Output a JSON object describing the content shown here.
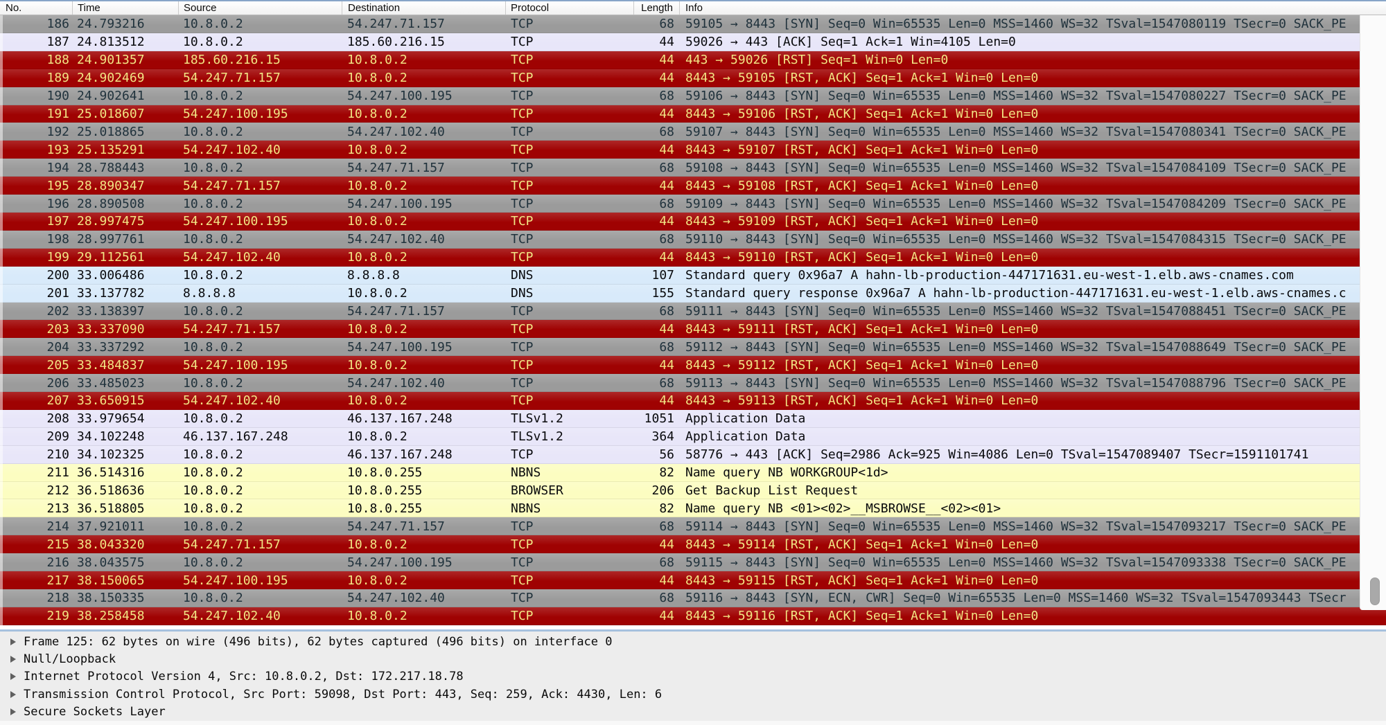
{
  "columns": [
    "No.",
    "Time",
    "Source",
    "Destination",
    "Protocol",
    "Length",
    "Info"
  ],
  "row_styles": {
    "gray": {
      "bg": "#9B9B9B",
      "fg": "#20323C"
    },
    "red": {
      "bg": "#9F0202",
      "fg": "#F2E584"
    },
    "lavender": {
      "bg": "#E8E6F9",
      "fg": "#08090C"
    },
    "blue": {
      "bg": "#D8EAFA",
      "fg": "#08090C"
    },
    "yellow": {
      "bg": "#FCFDC1",
      "fg": "#08090C"
    }
  },
  "chrome": {
    "top_border": "#87A5C8",
    "splitter_blue": "#A6C1DE",
    "scrollbar_thumb": "#A9A9A9",
    "header_separator": "#CBCBCB"
  },
  "packets": [
    {
      "no": "186",
      "time": "24.793216",
      "source": "10.8.0.2",
      "destination": "54.247.71.157",
      "protocol": "TCP",
      "length": "68",
      "info": "59105 → 8443 [SYN] Seq=0 Win=65535 Len=0 MSS=1460 WS=32 TSval=1547080119 TSecr=0 SACK_PE",
      "style": "gray"
    },
    {
      "no": "187",
      "time": "24.813512",
      "source": "10.8.0.2",
      "destination": "185.60.216.15",
      "protocol": "TCP",
      "length": "44",
      "info": "59026 → 443 [ACK] Seq=1 Ack=1 Win=4105 Len=0",
      "style": "lavender"
    },
    {
      "no": "188",
      "time": "24.901357",
      "source": "185.60.216.15",
      "destination": "10.8.0.2",
      "protocol": "TCP",
      "length": "44",
      "info": "443 → 59026 [RST] Seq=1 Win=0 Len=0",
      "style": "red"
    },
    {
      "no": "189",
      "time": "24.902469",
      "source": "54.247.71.157",
      "destination": "10.8.0.2",
      "protocol": "TCP",
      "length": "44",
      "info": "8443 → 59105 [RST, ACK] Seq=1 Ack=1 Win=0 Len=0",
      "style": "red"
    },
    {
      "no": "190",
      "time": "24.902641",
      "source": "10.8.0.2",
      "destination": "54.247.100.195",
      "protocol": "TCP",
      "length": "68",
      "info": "59106 → 8443 [SYN] Seq=0 Win=65535 Len=0 MSS=1460 WS=32 TSval=1547080227 TSecr=0 SACK_PE",
      "style": "gray"
    },
    {
      "no": "191",
      "time": "25.018607",
      "source": "54.247.100.195",
      "destination": "10.8.0.2",
      "protocol": "TCP",
      "length": "44",
      "info": "8443 → 59106 [RST, ACK] Seq=1 Ack=1 Win=0 Len=0",
      "style": "red"
    },
    {
      "no": "192",
      "time": "25.018865",
      "source": "10.8.0.2",
      "destination": "54.247.102.40",
      "protocol": "TCP",
      "length": "68",
      "info": "59107 → 8443 [SYN] Seq=0 Win=65535 Len=0 MSS=1460 WS=32 TSval=1547080341 TSecr=0 SACK_PE",
      "style": "gray"
    },
    {
      "no": "193",
      "time": "25.135291",
      "source": "54.247.102.40",
      "destination": "10.8.0.2",
      "protocol": "TCP",
      "length": "44",
      "info": "8443 → 59107 [RST, ACK] Seq=1 Ack=1 Win=0 Len=0",
      "style": "red"
    },
    {
      "no": "194",
      "time": "28.788443",
      "source": "10.8.0.2",
      "destination": "54.247.71.157",
      "protocol": "TCP",
      "length": "68",
      "info": "59108 → 8443 [SYN] Seq=0 Win=65535 Len=0 MSS=1460 WS=32 TSval=1547084109 TSecr=0 SACK_PE",
      "style": "gray"
    },
    {
      "no": "195",
      "time": "28.890347",
      "source": "54.247.71.157",
      "destination": "10.8.0.2",
      "protocol": "TCP",
      "length": "44",
      "info": "8443 → 59108 [RST, ACK] Seq=1 Ack=1 Win=0 Len=0",
      "style": "red"
    },
    {
      "no": "196",
      "time": "28.890508",
      "source": "10.8.0.2",
      "destination": "54.247.100.195",
      "protocol": "TCP",
      "length": "68",
      "info": "59109 → 8443 [SYN] Seq=0 Win=65535 Len=0 MSS=1460 WS=32 TSval=1547084209 TSecr=0 SACK_PE",
      "style": "gray"
    },
    {
      "no": "197",
      "time": "28.997475",
      "source": "54.247.100.195",
      "destination": "10.8.0.2",
      "protocol": "TCP",
      "length": "44",
      "info": "8443 → 59109 [RST, ACK] Seq=1 Ack=1 Win=0 Len=0",
      "style": "red"
    },
    {
      "no": "198",
      "time": "28.997761",
      "source": "10.8.0.2",
      "destination": "54.247.102.40",
      "protocol": "TCP",
      "length": "68",
      "info": "59110 → 8443 [SYN] Seq=0 Win=65535 Len=0 MSS=1460 WS=32 TSval=1547084315 TSecr=0 SACK_PE",
      "style": "gray"
    },
    {
      "no": "199",
      "time": "29.112561",
      "source": "54.247.102.40",
      "destination": "10.8.0.2",
      "protocol": "TCP",
      "length": "44",
      "info": "8443 → 59110 [RST, ACK] Seq=1 Ack=1 Win=0 Len=0",
      "style": "red"
    },
    {
      "no": "200",
      "time": "33.006486",
      "source": "10.8.0.2",
      "destination": "8.8.8.8",
      "protocol": "DNS",
      "length": "107",
      "info": "Standard query 0x96a7 A hahn-lb-production-447171631.eu-west-1.elb.aws-cnames.com",
      "style": "blue"
    },
    {
      "no": "201",
      "time": "33.137782",
      "source": "8.8.8.8",
      "destination": "10.8.0.2",
      "protocol": "DNS",
      "length": "155",
      "info": "Standard query response 0x96a7 A hahn-lb-production-447171631.eu-west-1.elb.aws-cnames.c",
      "style": "blue"
    },
    {
      "no": "202",
      "time": "33.138397",
      "source": "10.8.0.2",
      "destination": "54.247.71.157",
      "protocol": "TCP",
      "length": "68",
      "info": "59111 → 8443 [SYN] Seq=0 Win=65535 Len=0 MSS=1460 WS=32 TSval=1547088451 TSecr=0 SACK_PE",
      "style": "gray"
    },
    {
      "no": "203",
      "time": "33.337090",
      "source": "54.247.71.157",
      "destination": "10.8.0.2",
      "protocol": "TCP",
      "length": "44",
      "info": "8443 → 59111 [RST, ACK] Seq=1 Ack=1 Win=0 Len=0",
      "style": "red"
    },
    {
      "no": "204",
      "time": "33.337292",
      "source": "10.8.0.2",
      "destination": "54.247.100.195",
      "protocol": "TCP",
      "length": "68",
      "info": "59112 → 8443 [SYN] Seq=0 Win=65535 Len=0 MSS=1460 WS=32 TSval=1547088649 TSecr=0 SACK_PE",
      "style": "gray"
    },
    {
      "no": "205",
      "time": "33.484837",
      "source": "54.247.100.195",
      "destination": "10.8.0.2",
      "protocol": "TCP",
      "length": "44",
      "info": "8443 → 59112 [RST, ACK] Seq=1 Ack=1 Win=0 Len=0",
      "style": "red"
    },
    {
      "no": "206",
      "time": "33.485023",
      "source": "10.8.0.2",
      "destination": "54.247.102.40",
      "protocol": "TCP",
      "length": "68",
      "info": "59113 → 8443 [SYN] Seq=0 Win=65535 Len=0 MSS=1460 WS=32 TSval=1547088796 TSecr=0 SACK_PE",
      "style": "gray"
    },
    {
      "no": "207",
      "time": "33.650915",
      "source": "54.247.102.40",
      "destination": "10.8.0.2",
      "protocol": "TCP",
      "length": "44",
      "info": "8443 → 59113 [RST, ACK] Seq=1 Ack=1 Win=0 Len=0",
      "style": "red"
    },
    {
      "no": "208",
      "time": "33.979654",
      "source": "10.8.0.2",
      "destination": "46.137.167.248",
      "protocol": "TLSv1.2",
      "length": "1051",
      "info": "Application Data",
      "style": "lavender"
    },
    {
      "no": "209",
      "time": "34.102248",
      "source": "46.137.167.248",
      "destination": "10.8.0.2",
      "protocol": "TLSv1.2",
      "length": "364",
      "info": "Application Data",
      "style": "lavender"
    },
    {
      "no": "210",
      "time": "34.102325",
      "source": "10.8.0.2",
      "destination": "46.137.167.248",
      "protocol": "TCP",
      "length": "56",
      "info": "58776 → 443 [ACK] Seq=2986 Ack=925 Win=4086 Len=0 TSval=1547089407 TSecr=1591101741",
      "style": "lavender"
    },
    {
      "no": "211",
      "time": "36.514316",
      "source": "10.8.0.2",
      "destination": "10.8.0.255",
      "protocol": "NBNS",
      "length": "82",
      "info": "Name query NB WORKGROUP<1d>",
      "style": "yellow"
    },
    {
      "no": "212",
      "time": "36.518636",
      "source": "10.8.0.2",
      "destination": "10.8.0.255",
      "protocol": "BROWSER",
      "length": "206",
      "info": "Get Backup List Request",
      "style": "yellow"
    },
    {
      "no": "213",
      "time": "36.518805",
      "source": "10.8.0.2",
      "destination": "10.8.0.255",
      "protocol": "NBNS",
      "length": "82",
      "info": "Name query NB <01><02>__MSBROWSE__<02><01>",
      "style": "yellow"
    },
    {
      "no": "214",
      "time": "37.921011",
      "source": "10.8.0.2",
      "destination": "54.247.71.157",
      "protocol": "TCP",
      "length": "68",
      "info": "59114 → 8443 [SYN] Seq=0 Win=65535 Len=0 MSS=1460 WS=32 TSval=1547093217 TSecr=0 SACK_PE",
      "style": "gray"
    },
    {
      "no": "215",
      "time": "38.043320",
      "source": "54.247.71.157",
      "destination": "10.8.0.2",
      "protocol": "TCP",
      "length": "44",
      "info": "8443 → 59114 [RST, ACK] Seq=1 Ack=1 Win=0 Len=0",
      "style": "red"
    },
    {
      "no": "216",
      "time": "38.043575",
      "source": "10.8.0.2",
      "destination": "54.247.100.195",
      "protocol": "TCP",
      "length": "68",
      "info": "59115 → 8443 [SYN] Seq=0 Win=65535 Len=0 MSS=1460 WS=32 TSval=1547093338 TSecr=0 SACK_PE",
      "style": "gray"
    },
    {
      "no": "217",
      "time": "38.150065",
      "source": "54.247.100.195",
      "destination": "10.8.0.2",
      "protocol": "TCP",
      "length": "44",
      "info": "8443 → 59115 [RST, ACK] Seq=1 Ack=1 Win=0 Len=0",
      "style": "red"
    },
    {
      "no": "218",
      "time": "38.150335",
      "source": "10.8.0.2",
      "destination": "54.247.102.40",
      "protocol": "TCP",
      "length": "68",
      "info": "59116 → 8443 [SYN, ECN, CWR] Seq=0 Win=65535 Len=0 MSS=1460 WS=32 TSval=1547093443 TSecr",
      "style": "gray"
    },
    {
      "no": "219",
      "time": "38.258458",
      "source": "54.247.102.40",
      "destination": "10.8.0.2",
      "protocol": "TCP",
      "length": "44",
      "info": "8443 → 59116 [RST, ACK] Seq=1 Ack=1 Win=0 Len=0",
      "style": "red"
    }
  ],
  "details": [
    "Frame 125: 62 bytes on wire (496 bits), 62 bytes captured (496 bits) on interface 0",
    "Null/Loopback",
    "Internet Protocol Version 4, Src: 10.8.0.2, Dst: 172.217.18.78",
    "Transmission Control Protocol, Src Port: 59098, Dst Port: 443, Seq: 259, Ack: 4430, Len: 6",
    "Secure Sockets Layer"
  ]
}
